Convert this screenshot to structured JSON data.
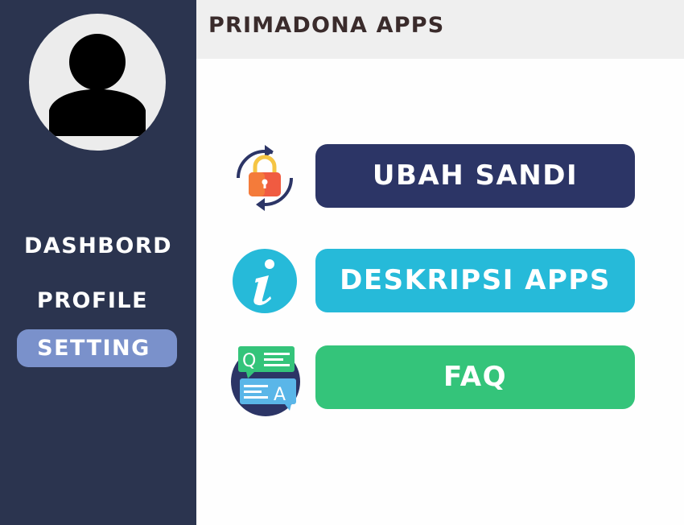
{
  "app": {
    "title": "PRIMADONA APPS"
  },
  "sidebar": {
    "items": [
      {
        "label": "DASHBORD",
        "active": false
      },
      {
        "label": "PROFILE",
        "active": false
      },
      {
        "label": "SETTING",
        "active": true
      }
    ]
  },
  "settings_menu": [
    {
      "label": "UBAH SANDI",
      "icon": "lock-refresh-icon",
      "color": "#2c3566"
    },
    {
      "label": "DESKRIPSI APPS",
      "icon": "info-icon",
      "color": "#26bad9"
    },
    {
      "label": "FAQ",
      "icon": "faq-icon",
      "color": "#34c47a"
    }
  ],
  "colors": {
    "sidebar": "#2b344f",
    "active_nav": "#7a91cb",
    "header": "#efefef"
  }
}
